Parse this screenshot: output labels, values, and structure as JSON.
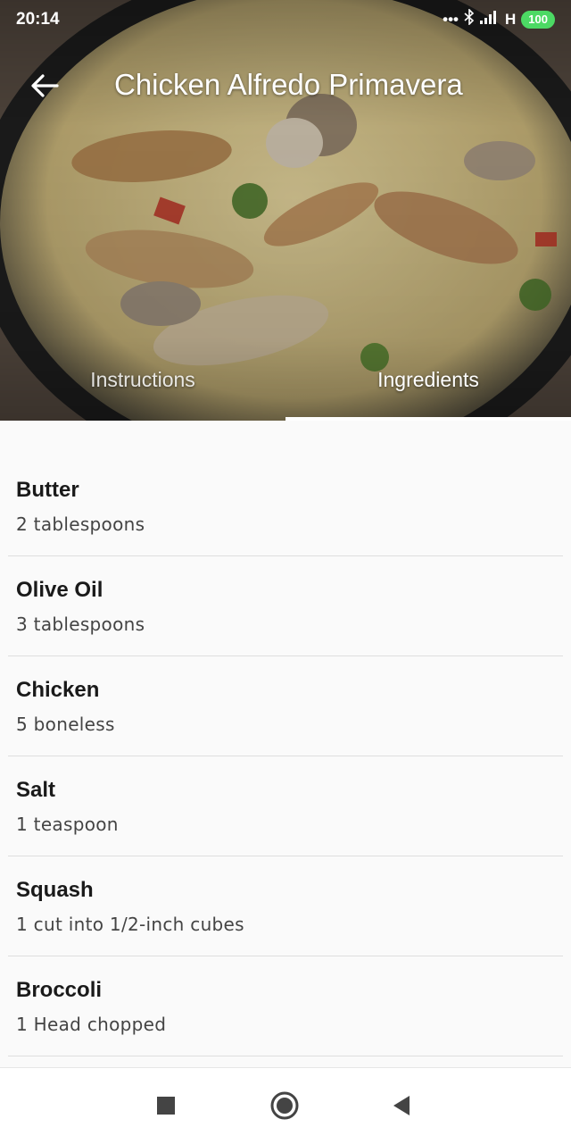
{
  "status": {
    "time": "20:14",
    "network": "H",
    "battery": "100"
  },
  "header": {
    "title": "Chicken Alfredo Primavera"
  },
  "tabs": [
    {
      "label": "Instructions",
      "active": false
    },
    {
      "label": "Ingredients",
      "active": true
    }
  ],
  "ingredients": [
    {
      "name": "Butter",
      "amount": "2 tablespoons"
    },
    {
      "name": "Olive Oil",
      "amount": "3 tablespoons"
    },
    {
      "name": "Chicken",
      "amount": "5 boneless"
    },
    {
      "name": "Salt",
      "amount": "1 teaspoon"
    },
    {
      "name": "Squash",
      "amount": "1 cut into 1/2-inch cubes"
    },
    {
      "name": "Broccoli",
      "amount": "1 Head chopped"
    }
  ],
  "icons": {
    "back": "arrow-left-icon",
    "recents": "square-icon",
    "home": "circle-icon",
    "nav_back": "triangle-back-icon"
  },
  "colors": {
    "background": "#fafafa",
    "battery": "#4cd964"
  }
}
